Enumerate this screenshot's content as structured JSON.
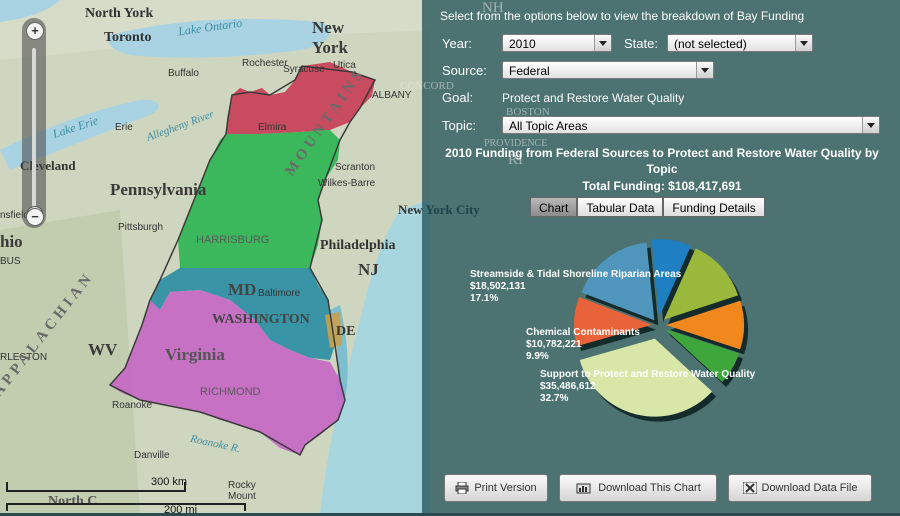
{
  "map": {
    "labels": {
      "north_york": "North York",
      "toronto": "Toronto",
      "lake_ontario": "Lake Ontario",
      "new_york": "New\nYork",
      "rochester": "Rochester",
      "syracuse": "Syracuse",
      "utica": "Utica",
      "buffalo": "Buffalo",
      "albany": "ALBANY",
      "concord": "CONCORD",
      "lake_erie": "Lake Erie",
      "erie": "Erie",
      "allegheny_river": "Allegheny River",
      "elmira": "Elmira",
      "cleveland": "Cleveland",
      "pennsylvania": "Pennsylvania",
      "scranton": "Scranton",
      "wilkes_barre": "Wilkes-Barre",
      "new_york_city": "New York City",
      "sfield": "nsfield",
      "ohio": "hio",
      "bus": "BUS",
      "pittsburgh": "Pittsburgh",
      "harrisburg": "HARRISBURG",
      "philadelphia": "Philadelphia",
      "nj": "NJ",
      "md": "MD",
      "baltimore": "Baltimore",
      "washington": "WASHINGTON",
      "de": "DE",
      "virginia": "Virginia",
      "wv": "WV",
      "rleston": "RLESTON",
      "richmond": "RICHMOND",
      "roanoke": "Roanoke",
      "roanoke_r": "Roanoke R.",
      "danville": "Danville",
      "rocky_mount": "Rocky\nMount",
      "appalachian": "APPALACHIAN",
      "mountains": "MOUNTAINS",
      "nh": "NH",
      "boston": "BOSTON",
      "providence": "PROVIDENCE",
      "ri": "RI",
      "north_c": "North C"
    },
    "scale": {
      "km": "300 km",
      "mi": "200 mi"
    }
  },
  "panel": {
    "intro": "Select from the options below to view the breakdown of Bay Funding",
    "year": {
      "label": "Year:",
      "value": "2010"
    },
    "state": {
      "label": "State:",
      "value": "(not selected)"
    },
    "source": {
      "label": "Source:",
      "value": "Federal"
    },
    "goal": {
      "label": "Goal:",
      "value": "Protect and Restore Water Quality"
    },
    "topic": {
      "label": "Topic:",
      "value": "All Topic Areas"
    },
    "chart_title": "2010 Funding from Federal Sources to Protect and Restore Water Quality by Topic",
    "total": "Total Funding: $108,417,691",
    "tabs": [
      "Chart",
      "Tabular Data",
      "Funding Details"
    ],
    "active_tab": "Chart",
    "buttons": {
      "print": "Print Version",
      "download_chart": "Download This Chart",
      "download_file": "Download Data File"
    }
  },
  "chart_data": {
    "type": "pie",
    "title": "2010 Funding from Federal Sources to Protect and Restore Water Quality by Topic",
    "slices": [
      {
        "label": "",
        "percent": 8.0,
        "color": "#1e7fc2"
      },
      {
        "label": "",
        "percent": 12.9,
        "color": "#9ab83c"
      },
      {
        "label": "",
        "percent": 9.8,
        "color": "#f0881e"
      },
      {
        "label": "",
        "percent": 6.6,
        "color": "#3fa63c"
      },
      {
        "label": "Support to Protect and Restore Water Quality",
        "value": "$35,486,612",
        "percent": 32.7,
        "display_percent": "32.7%",
        "color": "#d8e7a8"
      },
      {
        "label": "Chemical Contaminants",
        "value": "$10,782,221",
        "percent": 9.9,
        "display_percent": "9.9%",
        "color": "#e9633a"
      },
      {
        "label": "Streamside & Tidal Shoreline Riparian Areas",
        "value": "$18,502,131",
        "percent": 17.1,
        "display_percent": "17.1%",
        "color": "#4f95bc"
      }
    ]
  }
}
